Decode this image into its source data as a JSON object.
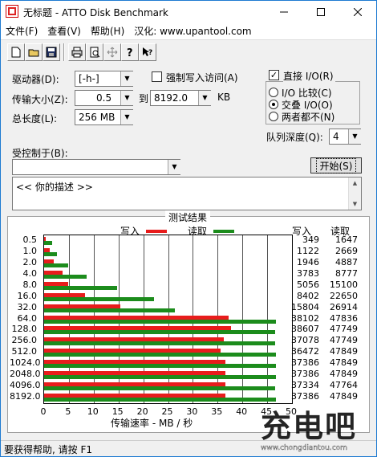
{
  "window": {
    "title": "无标题 - ATTO Disk Benchmark"
  },
  "menu": {
    "items": [
      "文件(F)",
      "查看(V)",
      "帮助(H)",
      "汉化: www.upantool.com"
    ]
  },
  "controls": {
    "drive_label": "驱动器(D):",
    "drive_value": "[-h-]",
    "force_write_label": "强制写入访问(A)",
    "transfer_label": "传输大小(Z):",
    "transfer_from": "0.5",
    "to_label": "到",
    "transfer_to": "8192.0",
    "kb_label": "KB",
    "length_label": "总长度(L):",
    "length_value": "256 MB",
    "direct_io_label": "直接 I/O(R)",
    "io_compare_label": "I/O 比较(C)",
    "overlap_io_label": "交叠 I/O(O)",
    "neither_label": "两者都不(N)",
    "queue_label": "队列深度(Q):",
    "queue_value": "4",
    "controlled_label": "受控制于(B):",
    "controlled_value": "",
    "start_button": "开始(S)",
    "description_text": "<<   你的描述   >>"
  },
  "results": {
    "title": "测试结果",
    "legend_write": "写入",
    "legend_read": "读取",
    "col_write": "写入",
    "col_read": "读取",
    "colors": {
      "write": "#e81c1c",
      "read": "#1c8c1c"
    }
  },
  "chart_data": {
    "type": "bar",
    "orientation": "horizontal",
    "title": "测试结果",
    "xlabel": "传输速率 - MB / 秒",
    "xlim": [
      0,
      50
    ],
    "xticks": [
      "0",
      "5",
      "10",
      "15",
      "20",
      "25",
      "30",
      "35",
      "40",
      "45",
      "50"
    ],
    "categories": [
      "0.5",
      "1.0",
      "2.0",
      "4.0",
      "8.0",
      "16.0",
      "32.0",
      "64.0",
      "128.0",
      "256.0",
      "512.0",
      "1024.0",
      "2048.0",
      "4096.0",
      "8192.0"
    ],
    "series": [
      {
        "name": "写入",
        "values": [
          0.34,
          1.1,
          1.9,
          3.7,
          4.9,
          8.2,
          15.4,
          37.2,
          37.7,
          36.2,
          35.6,
          36.5,
          36.5,
          36.5,
          36.5
        ]
      },
      {
        "name": "读取",
        "values": [
          1.6,
          2.6,
          4.8,
          8.6,
          14.7,
          22.1,
          26.3,
          46.7,
          46.6,
          46.6,
          46.7,
          46.7,
          46.7,
          46.6,
          46.7
        ]
      }
    ],
    "write_kb": [
      "349",
      "1122",
      "1946",
      "3783",
      "5056",
      "8402",
      "15804",
      "38102",
      "38607",
      "37078",
      "36472",
      "37386",
      "37386",
      "37334",
      "37386"
    ],
    "read_kb": [
      "1647",
      "2669",
      "4887",
      "8777",
      "15100",
      "22650",
      "26914",
      "47836",
      "47749",
      "47749",
      "47849",
      "47849",
      "47849",
      "47764",
      "47849"
    ],
    "grid": true
  },
  "status": {
    "text": "要获得帮助, 请按 F1"
  },
  "watermark": {
    "text": "充电吧",
    "url": "www.chongdiantou.com"
  }
}
